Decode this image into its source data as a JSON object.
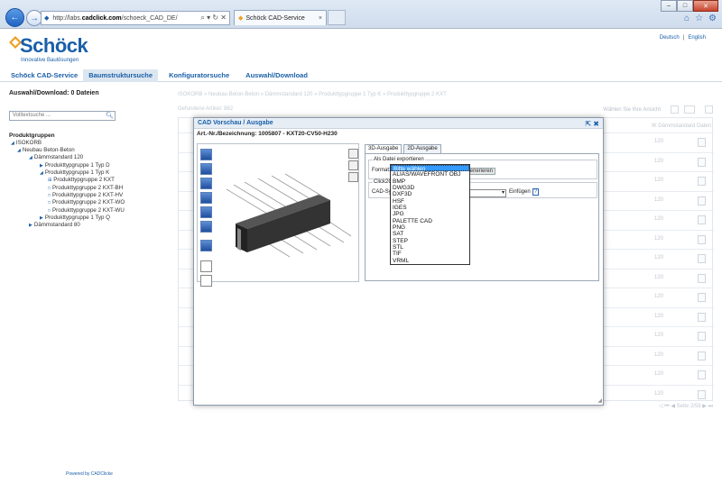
{
  "browser": {
    "url_prefix": "http://labs.",
    "url_domain": "cadclick.com",
    "url_path": "/schoeck_CAD_DE/",
    "addr_tools": "⌕ ▾ ↻ ✕",
    "tab_title": "Schöck CAD-Service",
    "tab_close": "×"
  },
  "header": {
    "logo_text": "Schöck",
    "logo_sub": "Innovative Baulösungen",
    "lang_de": "Deutsch",
    "lang_sep": "|",
    "lang_en": "English"
  },
  "nav": {
    "items": [
      "Schöck CAD-Service",
      "Baumstrukturs uche",
      "Konfiguratorsuche",
      "Auswahl/Download"
    ]
  },
  "left": {
    "download_label": "Auswahl/Download:",
    "download_count": "0",
    "download_unit": "Dateien",
    "search_placeholder": "Volltextsuche ...",
    "groups_title": "Produktgruppen",
    "tree": [
      "ISOKORB",
      "Neubau Beton-Beton",
      "Dämmstandard 120",
      "Produkttypgruppe 1 Typ D",
      "Produkttypgruppe 1 Typ K",
      "Produkttypgruppe 2 KXT",
      "Produkttypgruppe 2 KXT-BH",
      "Produkttypgruppe 2 KXT-HV",
      "Produkttypgruppe 2 KXT-WO",
      "Produkttypgruppe 2 KXT-WU",
      "Produkttypgruppe 1 Typ Q",
      "Dämmstandard 80"
    ]
  },
  "background": {
    "breadcrumb": "ISOKORB » Neubau Beton-Beton » Dämmstandard 120 » Produkttypgruppe 1 Typ K » Produkttypgruppe 2 KXT",
    "found": "Gefundene Artikel: 882",
    "view_label": "Wählen Sie Ihre Ansicht",
    "col_header": "IK Dämmstandard  Daten",
    "row_value": "120",
    "pager": "Seite 2/59"
  },
  "footer": {
    "powered": "Powered by CADClicke"
  },
  "dialog": {
    "title": "CAD Vorschau / Ausgabe",
    "title_buttons": "⇱ ✖",
    "article": "Art.-Nr./Bezeichnung: 1005807 - KXT20-CV50-H230",
    "tabs": [
      "3D-Ausgabe",
      "2D-Ausgabe"
    ],
    "export_legend": "Als Datei exportieren",
    "format_label": "Format:",
    "generate_btn": "Generieren",
    "click2cad_legend": "Click2CAD",
    "cad_system_label": "CAD-System",
    "insert_btn": "Einfügen",
    "help": "?"
  },
  "dropdown": {
    "options": [
      "Bitte wählen",
      "ALIAS/WAVEFRONT OBJ",
      "BMP",
      "DWG3D",
      "DXF3D",
      "HSF",
      "IGES",
      "JPG",
      "PALETTE CAD",
      "PNG",
      "SAT",
      "STEP",
      "STL",
      "TIF",
      "VRML"
    ],
    "selected_index": 0
  },
  "colors": {
    "brand": "#1a5fa8",
    "selection": "#3399ff"
  }
}
